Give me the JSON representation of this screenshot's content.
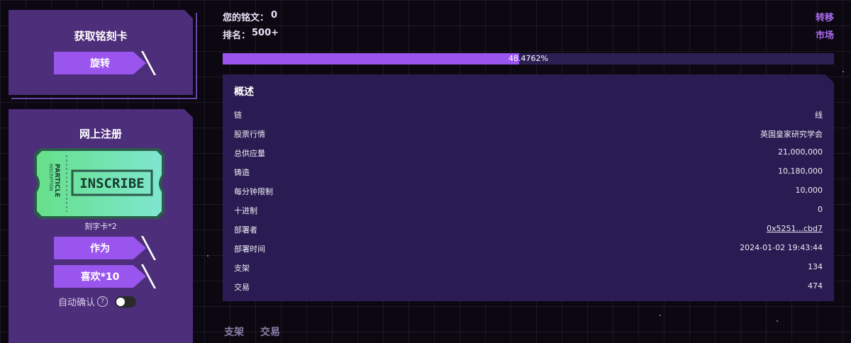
{
  "claim_panel": {
    "title": "获取铭刻卡",
    "spin_button": "旋转"
  },
  "register_panel": {
    "title": "网上注册",
    "ticket": {
      "brand_line1": "PARTICLE",
      "brand_line2": "INSCRIPTION",
      "label": "INSCRIBE"
    },
    "card_count": "刻字卡*2",
    "act_button": "作为",
    "like_button": "喜欢*10",
    "auto_confirm_label": "自动确认",
    "help_icon": "?"
  },
  "stats": {
    "my_inscriptions_label": "您的铭文：",
    "my_inscriptions_value": "0",
    "rank_label": "排名：",
    "rank_value": "500+",
    "transfer_link": "转移",
    "market_link": "市场"
  },
  "progress": {
    "text": "48.4762%",
    "value": 0.484762
  },
  "overview": {
    "title": "概述",
    "rows": [
      {
        "key": "链",
        "value": "线"
      },
      {
        "key": "股票行情",
        "value": "英国皇家研究学会"
      },
      {
        "key": "总供应量",
        "value": "21,000,000"
      },
      {
        "key": "铸造",
        "value": "10,180,000"
      },
      {
        "key": "每分钟限制",
        "value": "10,000"
      },
      {
        "key": "十进制",
        "value": "0"
      },
      {
        "key": "部署者",
        "value": "0x5251...cbd7"
      },
      {
        "key": "部署时间",
        "value": "2024-01-02 19:43:44"
      },
      {
        "key": "支架",
        "value": "134"
      },
      {
        "key": "交易",
        "value": "474"
      }
    ]
  },
  "bottom_tabs": [
    "支架",
    "交易"
  ],
  "colors": {
    "accent": "#9a55ee",
    "panel": "#4d2e7a",
    "card": "#2a1c52",
    "link": "#b06cf5"
  }
}
